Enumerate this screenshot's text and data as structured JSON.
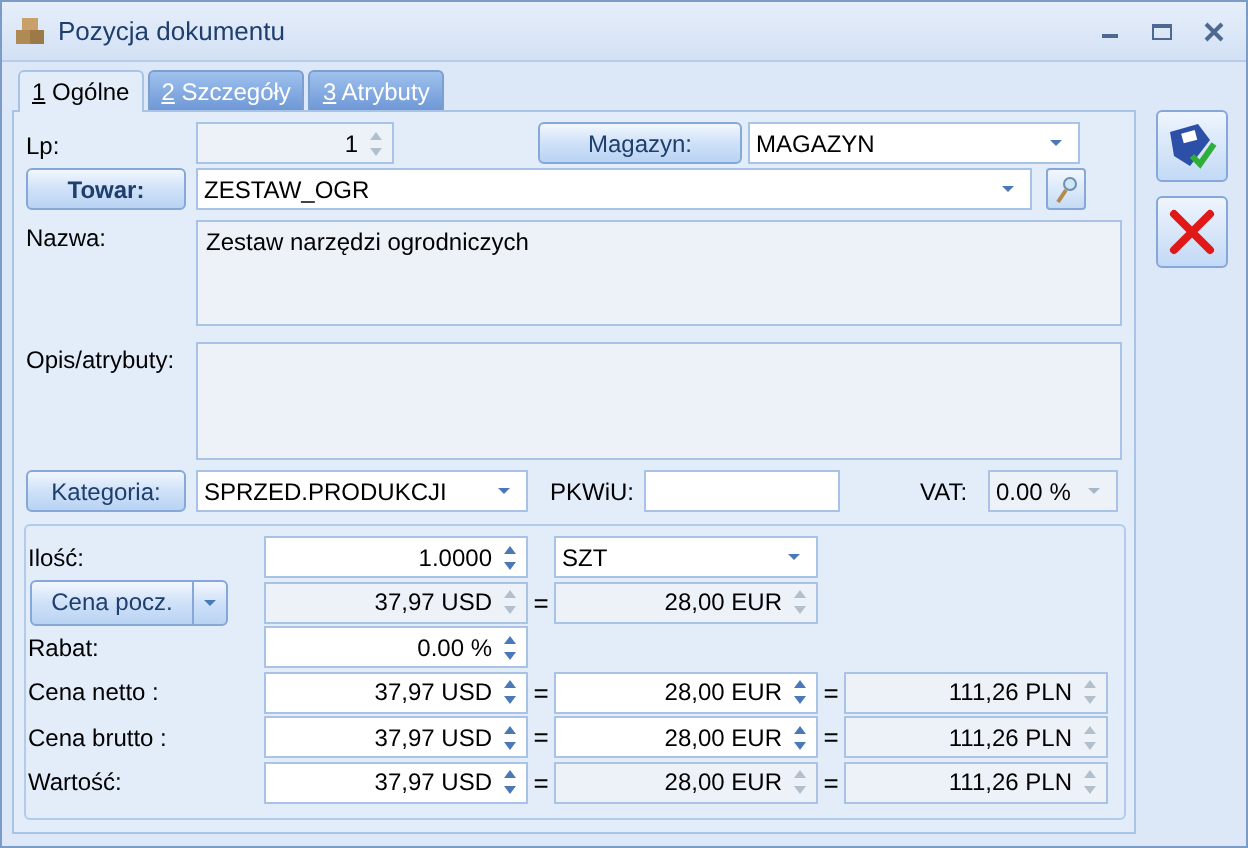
{
  "window": {
    "title": "Pozycja dokumentu"
  },
  "tabs": [
    {
      "hotkey": "1",
      "label": "Ogólne",
      "selected": true
    },
    {
      "hotkey": "2",
      "label": "Szczegóły",
      "selected": false
    },
    {
      "hotkey": "3",
      "label": "Atrybuty",
      "selected": false
    }
  ],
  "lp": {
    "label": "Lp:",
    "value": "1",
    "disabled": true
  },
  "magazyn": {
    "button": "Magazyn:",
    "value": "MAGAZYN"
  },
  "towar": {
    "button": "Towar:",
    "value": "ZESTAW_OGR"
  },
  "nazwa": {
    "label": "Nazwa:",
    "value": "Zestaw narzędzi ogrodniczych"
  },
  "opis": {
    "label": "Opis/atrybuty:"
  },
  "kategoria": {
    "button": "Kategoria:",
    "value": "SPRZED.PRODUKCJI"
  },
  "pkwiu": {
    "label": "PKWiU:"
  },
  "vat": {
    "label": "VAT:",
    "value": "0.00  %",
    "disabled": true
  },
  "rows": [
    {
      "kind": "label",
      "label": "Ilość:",
      "cells": [
        {
          "kind": "spinner",
          "value": "1.0000",
          "disabled": false
        },
        {
          "kind": "combo",
          "value": "SZT",
          "disabled": false
        }
      ]
    },
    {
      "kind": "split-button",
      "label": "Cena pocz.",
      "cells": [
        {
          "kind": "spinner",
          "value": "37,97 USD",
          "disabled": true
        },
        {
          "kind": "spinner",
          "sep": "=",
          "value": "28,00 EUR",
          "disabled": true
        }
      ]
    },
    {
      "kind": "label",
      "label": "Rabat:",
      "cells": [
        {
          "kind": "spinner",
          "value": "0.00 %",
          "disabled": false
        }
      ]
    },
    {
      "kind": "label",
      "label": "Cena netto :",
      "cells": [
        {
          "kind": "spinner",
          "value": "37,97 USD",
          "disabled": false
        },
        {
          "kind": "spinner",
          "sep": "=",
          "value": "28,00 EUR",
          "disabled": false
        },
        {
          "kind": "spinner",
          "sep": "=",
          "value": "111,26 PLN",
          "disabled": true
        }
      ]
    },
    {
      "kind": "label",
      "label": "Cena brutto :",
      "cells": [
        {
          "kind": "spinner",
          "value": "37,97 USD",
          "disabled": false
        },
        {
          "kind": "spinner",
          "sep": "=",
          "value": "28,00 EUR",
          "disabled": false
        },
        {
          "kind": "spinner",
          "sep": "=",
          "value": "111,26 PLN",
          "disabled": true
        }
      ]
    },
    {
      "kind": "label",
      "label": "Wartość:",
      "cells": [
        {
          "kind": "spinner",
          "value": "37,97 USD",
          "disabled": false
        },
        {
          "kind": "spinner",
          "sep": "=",
          "value": "28,00 EUR",
          "disabled": true
        },
        {
          "kind": "spinner",
          "sep": "=",
          "value": "111,26 PLN",
          "disabled": true
        }
      ]
    }
  ]
}
